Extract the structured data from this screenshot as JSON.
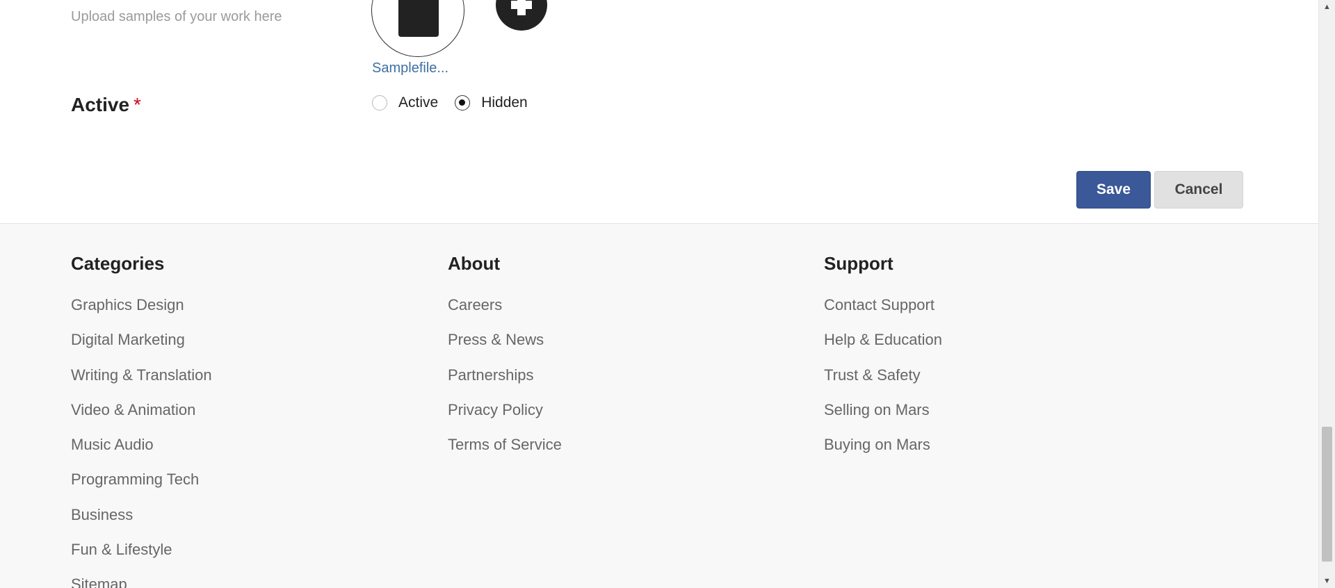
{
  "form": {
    "upload_hint": "Upload samples of your work here",
    "file_name": "Samplefile...",
    "active_label": "Active",
    "required_mark": "*",
    "radio_options": [
      {
        "label": "Active",
        "checked": false
      },
      {
        "label": "Hidden",
        "checked": true
      }
    ],
    "save_label": "Save",
    "cancel_label": "Cancel"
  },
  "footer": {
    "columns": [
      {
        "title": "Categories",
        "items": [
          "Graphics Design",
          "Digital Marketing",
          "Writing & Translation",
          "Video & Animation",
          "Music Audio",
          "Programming Tech",
          "Business",
          "Fun & Lifestyle",
          "Sitemap"
        ]
      },
      {
        "title": "About",
        "items": [
          "Careers",
          "Press & News",
          "Partnerships",
          "Privacy Policy",
          "Terms of Service"
        ]
      },
      {
        "title": "Support",
        "items": [
          "Contact Support",
          "Help & Education",
          "Trust & Safety",
          "Selling on Mars",
          "Buying on Mars"
        ]
      }
    ]
  },
  "colors": {
    "save_button": "#3b5898",
    "cancel_button": "#e1e1e1",
    "link": "#3f6fa3",
    "required": "#d0021b",
    "footer_bg": "#f8f8f8"
  },
  "icons": {
    "file": "file-icon",
    "add": "plus-icon",
    "scroll_up": "scroll-up-arrow-icon",
    "scroll_down": "scroll-down-arrow-icon"
  }
}
